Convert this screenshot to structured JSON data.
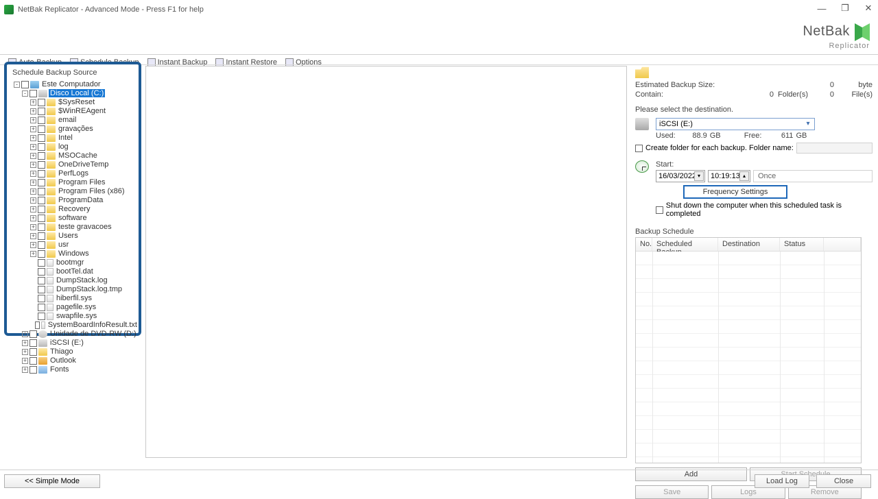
{
  "window": {
    "title": "NetBak Replicator - Advanced Mode - Press F1 for help"
  },
  "logo": {
    "brand": "NetBak",
    "sub": "Replicator"
  },
  "toolbar": {
    "auto_backup": "Auto-Backup",
    "schedule_backup": "Schedule Backup",
    "instant_backup": "Instant Backup",
    "instant_restore": "Instant Restore",
    "options": "Options"
  },
  "tree": {
    "title": "Schedule Backup Source",
    "root": "Este Computador",
    "disk_c": "Disco Local (C:)",
    "children_c": [
      {
        "t": "folder",
        "n": "$SysReset"
      },
      {
        "t": "folder",
        "n": "$WinREAgent"
      },
      {
        "t": "folder",
        "n": "email"
      },
      {
        "t": "folder",
        "n": "gravações"
      },
      {
        "t": "folder",
        "n": "Intel"
      },
      {
        "t": "folder",
        "n": "log"
      },
      {
        "t": "folder",
        "n": "MSOCache"
      },
      {
        "t": "folder",
        "n": "OneDriveTemp"
      },
      {
        "t": "folder",
        "n": "PerfLogs"
      },
      {
        "t": "folder",
        "n": "Program Files"
      },
      {
        "t": "folder",
        "n": "Program Files (x86)"
      },
      {
        "t": "folder",
        "n": "ProgramData"
      },
      {
        "t": "folder",
        "n": "Recovery"
      },
      {
        "t": "folder",
        "n": "software"
      },
      {
        "t": "folder",
        "n": "teste gravacoes"
      },
      {
        "t": "folder",
        "n": "Users"
      },
      {
        "t": "folder",
        "n": "usr"
      },
      {
        "t": "folder",
        "n": "Windows"
      },
      {
        "t": "file",
        "n": "bootmgr"
      },
      {
        "t": "file",
        "n": "bootTel.dat"
      },
      {
        "t": "file",
        "n": "DumpStack.log"
      },
      {
        "t": "file",
        "n": "DumpStack.log.tmp"
      },
      {
        "t": "file",
        "n": "hiberfil.sys"
      },
      {
        "t": "file",
        "n": "pagefile.sys"
      },
      {
        "t": "file",
        "n": "swapfile.sys"
      },
      {
        "t": "file",
        "n": "SystemBoardInfoResult.txt"
      }
    ],
    "siblings": [
      {
        "t": "dvd",
        "n": "Unidade de DVD-RW (D:)"
      },
      {
        "t": "drive",
        "n": "iSCSI (E:)"
      },
      {
        "t": "folder",
        "n": "Thiago"
      },
      {
        "t": "outlook",
        "n": "Outlook"
      },
      {
        "t": "fonts",
        "n": "Fonts"
      }
    ]
  },
  "right": {
    "est_size_label": "Estimated Backup Size:",
    "est_size_val": "0",
    "est_size_unit": "byte",
    "contain_label": "Contain:",
    "folders_val": "0",
    "folders_unit": "Folder(s)",
    "files_val": "0",
    "files_unit": "File(s)",
    "select_dest_label": "Please select the destination.",
    "dest_value": "iSCSI (E:)",
    "used_label": "Used:",
    "used_val": "88.9",
    "used_unit": "GB",
    "free_label": "Free:",
    "free_val": "611",
    "free_unit": "GB",
    "create_folder_label": "Create folder for each backup. Folder name:",
    "start_label": "Start:",
    "date_val": "16/03/2022",
    "time_val": "10:19:13",
    "once_label": "Once",
    "freq_btn": "Frequency Settings",
    "shutdown_label": "Shut down the computer when this scheduled task is completed",
    "schedule_label": "Backup Schedule",
    "col_no": "No.",
    "col_sched": "Scheduled Backup",
    "col_dest": "Destination",
    "col_status": "Status",
    "btn_add": "Add",
    "btn_start": "Start Schedule",
    "btn_save": "Save",
    "btn_logs": "Logs",
    "btn_remove": "Remove"
  },
  "bottom": {
    "simple_mode": "<< Simple Mode",
    "load_log": "Load Log",
    "close": "Close"
  }
}
